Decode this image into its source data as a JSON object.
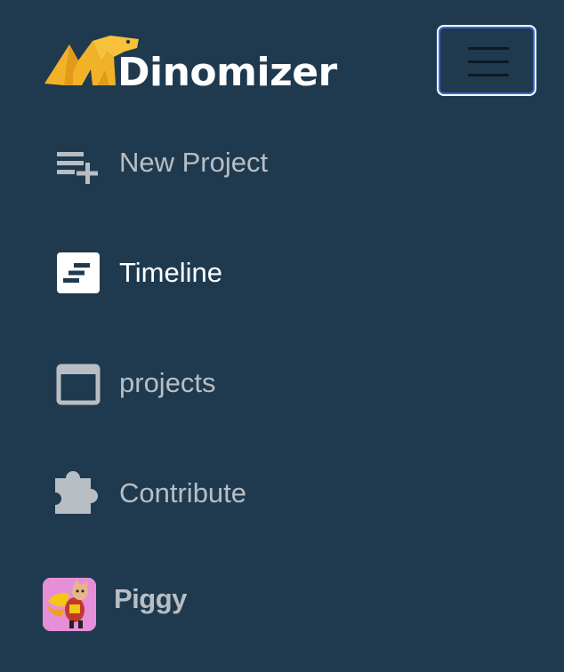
{
  "brand": {
    "name": "Dinomizer",
    "logo_color": "#f2b227"
  },
  "toggler": {
    "aria_label": "Toggle navigation"
  },
  "nav": {
    "items": [
      {
        "label": "New Project",
        "icon": "playlist-add-icon",
        "active": false
      },
      {
        "label": "Timeline",
        "icon": "timeline-icon",
        "active": true
      },
      {
        "label": "projects",
        "icon": "window-icon",
        "active": false
      },
      {
        "label": "Contribute",
        "icon": "puzzle-piece-icon",
        "active": false
      }
    ]
  },
  "user": {
    "name": "Piggy",
    "avatar_bg": "#e68fd9"
  },
  "colors": {
    "background": "#1f3a4f",
    "nav_text": "#b8bec4",
    "active_text": "#ffffff",
    "toggler_focus": "#2f6bd6"
  }
}
